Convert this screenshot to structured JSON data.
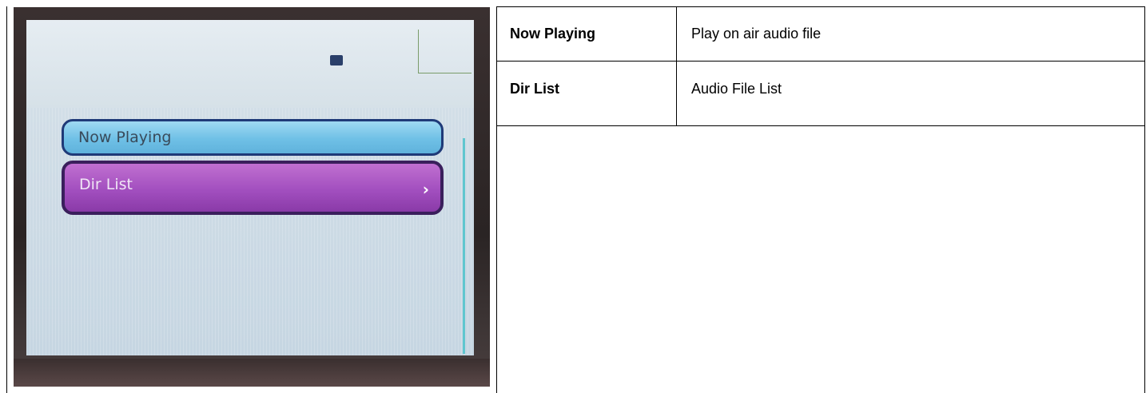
{
  "device_screen": {
    "menu": [
      {
        "label": "Now Playing",
        "state": "normal"
      },
      {
        "label": "Dir List",
        "state": "selected",
        "chevron": "›"
      }
    ],
    "icons": [
      "battery-icon",
      "chevron-right-icon"
    ]
  },
  "table": {
    "rows": [
      {
        "key": "Now Playing",
        "value": "Play on air audio file"
      },
      {
        "key": "Dir List",
        "value": "Audio File List"
      }
    ]
  }
}
